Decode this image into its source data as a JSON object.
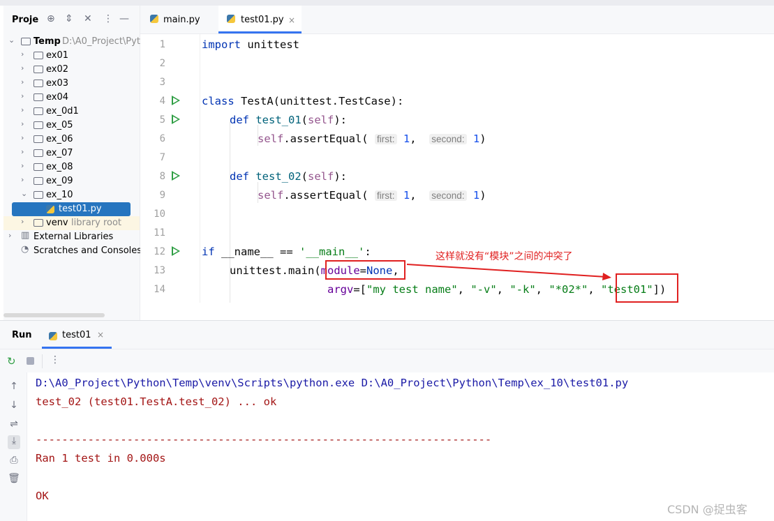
{
  "project_panel": {
    "title": "Proje",
    "tree": [
      {
        "label": "Temp",
        "hint": "D:\\A0_Project\\Pyt",
        "expanded": true,
        "type": "folder"
      },
      {
        "label": "ex01",
        "type": "folder"
      },
      {
        "label": "ex02",
        "type": "folder"
      },
      {
        "label": "ex03",
        "type": "folder"
      },
      {
        "label": "ex04",
        "type": "folder"
      },
      {
        "label": "ex_0d1",
        "type": "package"
      },
      {
        "label": "ex_05",
        "type": "package"
      },
      {
        "label": "ex_06",
        "type": "package"
      },
      {
        "label": "ex_07",
        "type": "package"
      },
      {
        "label": "ex_08",
        "type": "package"
      },
      {
        "label": "ex_09",
        "type": "package"
      },
      {
        "label": "ex_10",
        "type": "folder",
        "expanded": true
      },
      {
        "label": "test01.py",
        "type": "python-file",
        "selected": true
      },
      {
        "label": "venv",
        "hint": "library root",
        "type": "folder"
      },
      {
        "label": "External Libraries",
        "type": "library"
      },
      {
        "label": "Scratches and Consoles",
        "type": "scratch"
      }
    ]
  },
  "tabs": [
    {
      "label": "main.py",
      "active": false
    },
    {
      "label": "test01.py",
      "active": true,
      "close": "×"
    }
  ],
  "editor": {
    "line_numbers": [
      "1",
      "2",
      "3",
      "4",
      "5",
      "6",
      "7",
      "8",
      "9",
      "10",
      "11",
      "12",
      "13",
      "14"
    ],
    "lines": {
      "l1": {
        "kw": "import",
        "rest": " unittest"
      },
      "l4": {
        "kw": "class",
        "name": " TestA",
        "rest": "(unittest.TestCase):"
      },
      "l5": {
        "kw": "def",
        "name": " test_01",
        "open": "(",
        "self": "self",
        "close": "):"
      },
      "l6": {
        "self": "self",
        "call": ".assertEqual(",
        "hint1": "first:",
        "v1": "1",
        "comma": ",",
        "hint2": "second:",
        "v2": "1",
        "close": ")"
      },
      "l8": {
        "kw": "def",
        "name": " test_02",
        "open": "(",
        "self": "self",
        "close": "):"
      },
      "l9": {
        "self": "self",
        "call": ".assertEqual(",
        "hint1": "first:",
        "v1": "1",
        "comma": ",",
        "hint2": "second:",
        "v2": "1",
        "close": ")"
      },
      "l12": {
        "kw": "if",
        "rest": " __name__ == ",
        "str": "'__main__'",
        "colon": ":"
      },
      "l13": {
        "call": "unittest.main(",
        "param": "module",
        "eq": "=",
        "none": "None",
        "comma": ","
      },
      "l14": {
        "param": "argv",
        "eq": "=[",
        "s1": "\"my test name\"",
        "s2": "\"-v\"",
        "s3": "\"-k\"",
        "s4": "\"*02*\"",
        "s5": "\"test01\"",
        "sep": ", ",
        "close": "])"
      }
    },
    "annotation": "这样就没有“模块”之间的冲突了"
  },
  "run_panel": {
    "title": "Run",
    "tab_label": "test01",
    "tab_close": "×",
    "console": [
      "D:\\A0_Project\\Python\\Temp\\venv\\Scripts\\python.exe D:\\A0_Project\\Python\\Temp\\ex_10\\test01.py",
      "test_02 (test01.TestA.test_02) ... ok",
      "",
      "----------------------------------------------------------------------",
      "Ran 1 test in 0.000s",
      "",
      "OK"
    ]
  },
  "watermark": "CSDN @捉虫客",
  "colors": {
    "accent": "#3574f0",
    "selection": "#2675bf",
    "annotation_red": "#e02020",
    "run_green": "#2f9e44"
  }
}
